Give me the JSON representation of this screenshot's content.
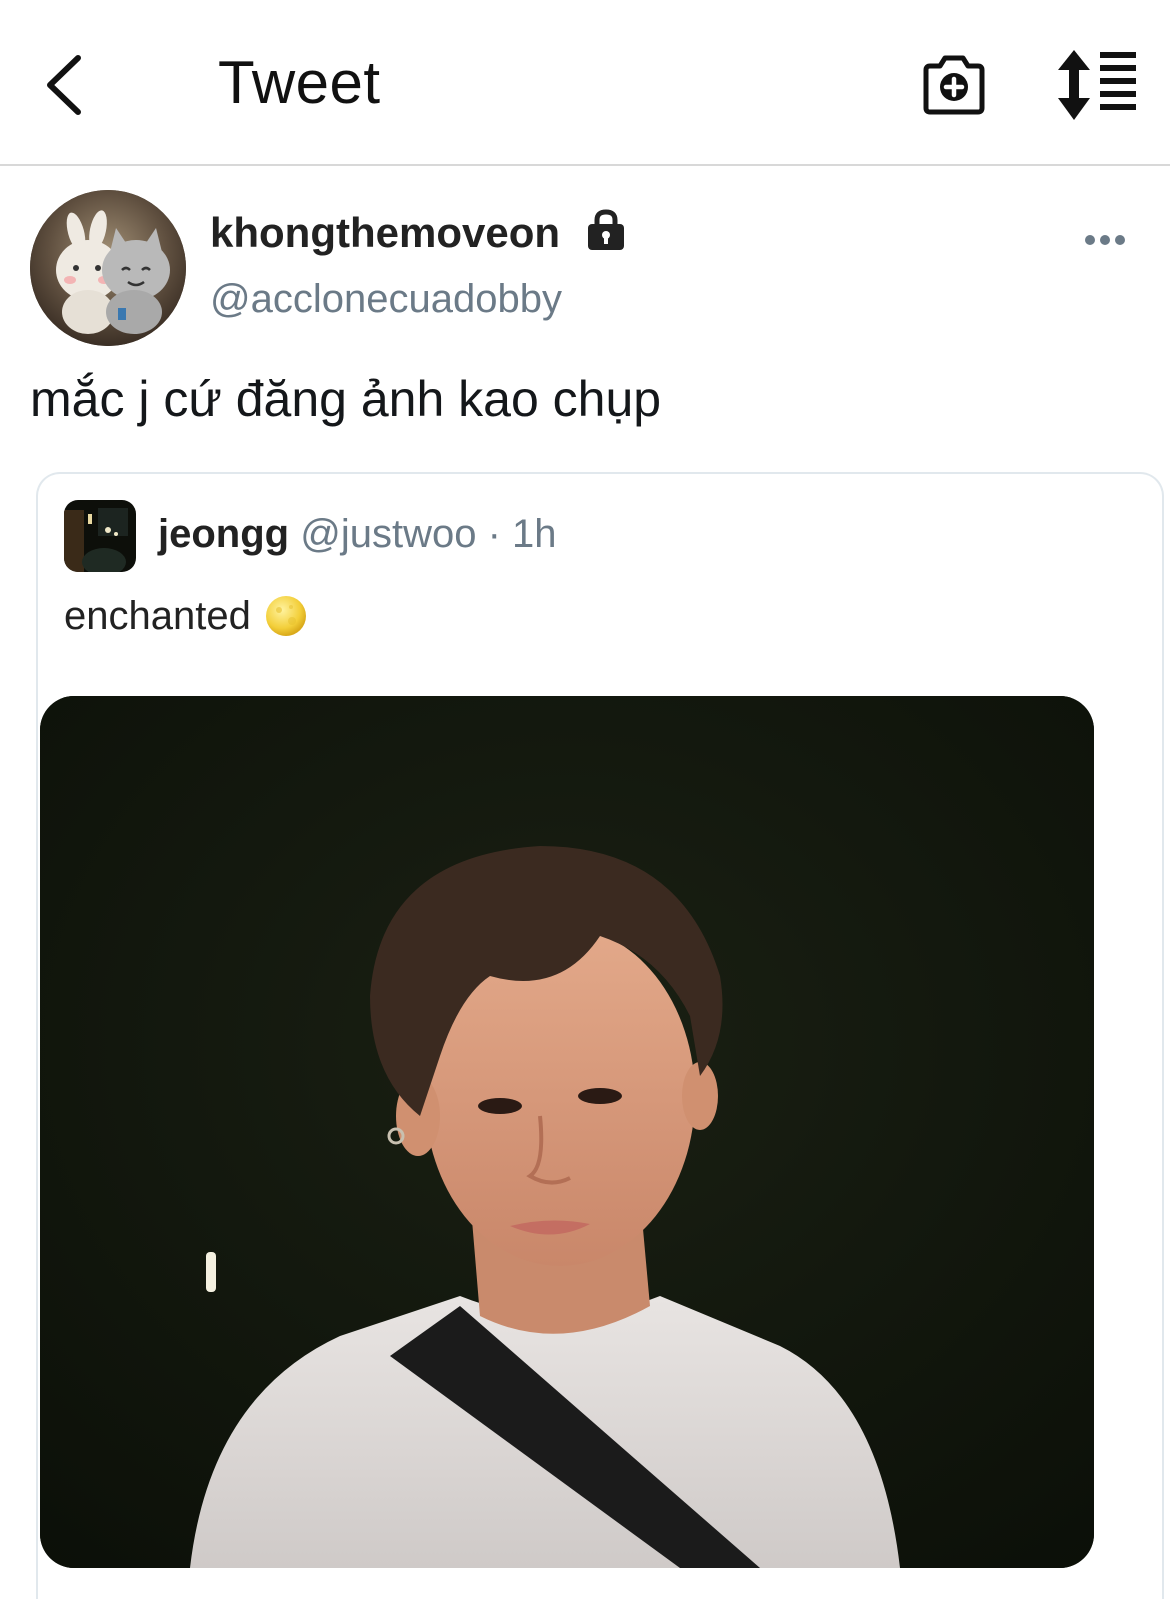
{
  "header": {
    "title": "Tweet",
    "back_icon": "chevron-left-icon",
    "camera_icon": "camera-plus-icon",
    "sort_icon": "sort-list-icon"
  },
  "tweet": {
    "display_name": "khongthemoveon",
    "protected_icon": "lock-icon",
    "handle": "@acclonecuadobby",
    "more_icon": "more-horizontal-icon",
    "text": "mắc j cứ đăng ảnh kao chụp"
  },
  "quoted_tweet": {
    "display_name": "jeongg",
    "handle": "@justwoo",
    "separator": "·",
    "time": "1h",
    "text": "enchanted",
    "emoji": "full-moon-emoji"
  },
  "colors": {
    "text_primary": "#14171a",
    "text_secondary": "#6b7a87",
    "border": "#e1e8ed",
    "photo_background": "#10150c"
  }
}
